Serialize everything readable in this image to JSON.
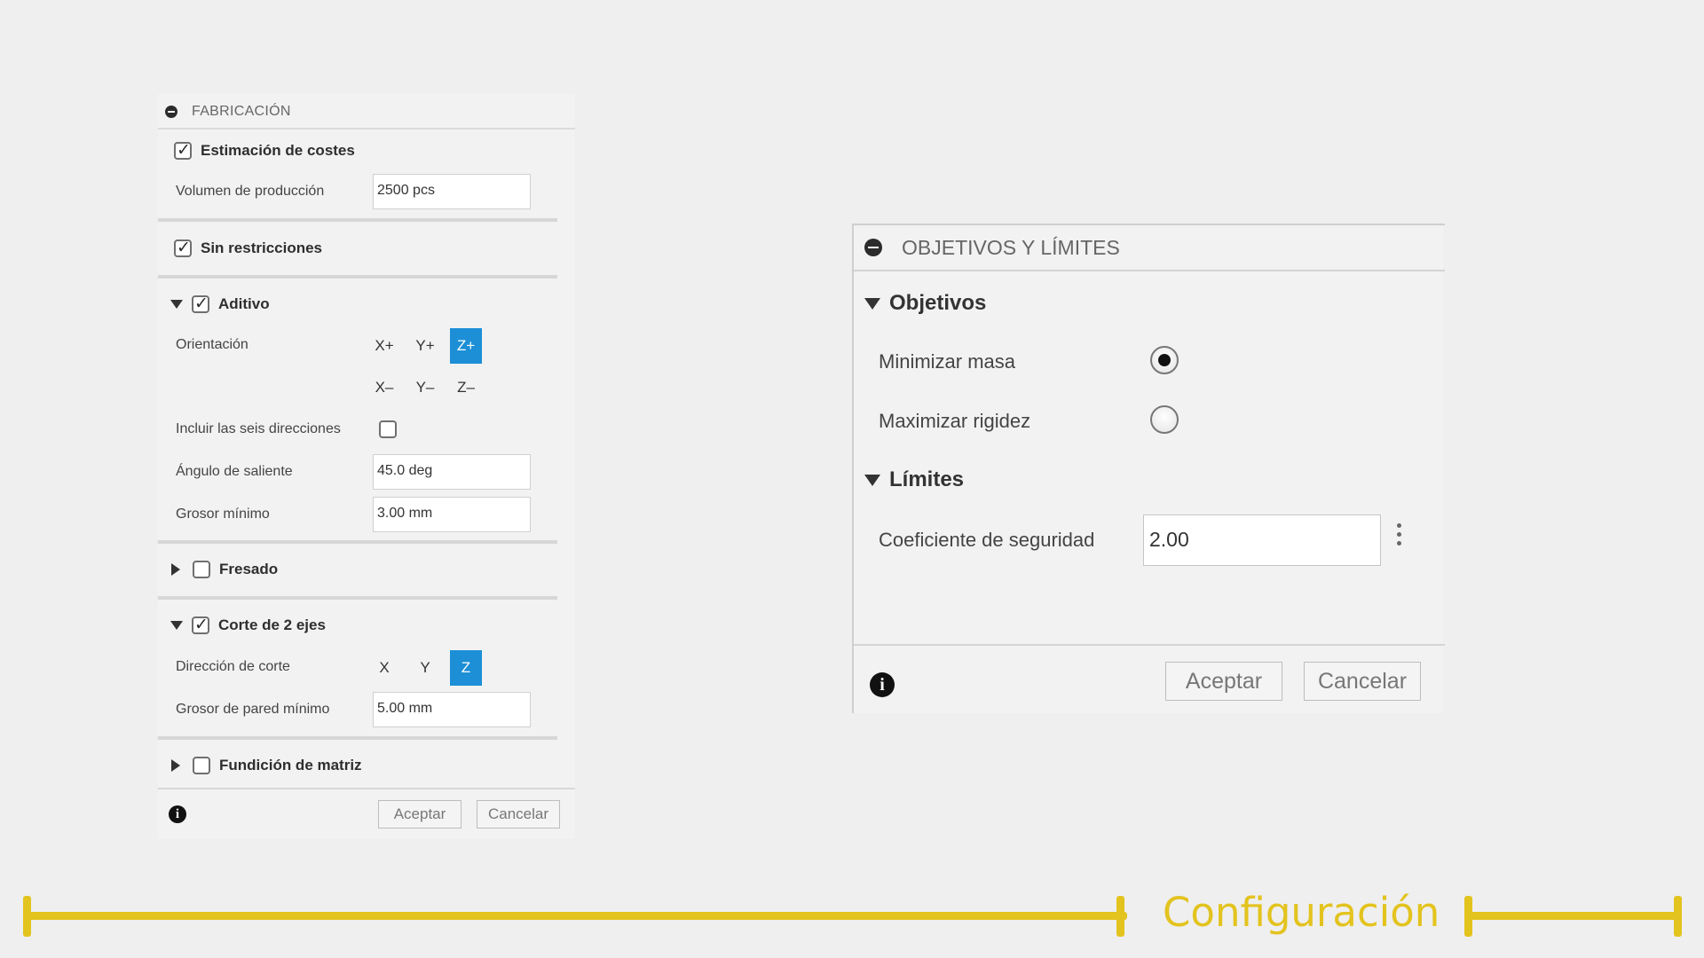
{
  "left_panel": {
    "title": "FABRICACIÓN",
    "cost_estimation": {
      "label": "Estimación de costes",
      "checked": true
    },
    "production_volume": {
      "label": "Volumen de producción",
      "value": "2500 pcs"
    },
    "unrestricted": {
      "label": "Sin restricciones",
      "checked": true
    },
    "additive": {
      "label": "Aditivo",
      "checked": true,
      "expanded": true,
      "orientation_label": "Orientación",
      "orientation_positive": [
        "X+",
        "Y+",
        "Z+"
      ],
      "orientation_negative": [
        "X–",
        "Y–",
        "Z–"
      ],
      "selected": "Z+",
      "six_directions_label": "Incluir las seis direcciones",
      "six_directions_checked": false,
      "overhang_label": "Ángulo de saliente",
      "overhang_value": "45.0 deg",
      "min_thickness_label": "Grosor mínimo",
      "min_thickness_value": "3.00 mm"
    },
    "milling": {
      "label": "Fresado",
      "checked": false,
      "expanded": false
    },
    "two_axis": {
      "label": "Corte de 2 ejes",
      "checked": true,
      "expanded": true,
      "direction_label": "Dirección de corte",
      "directions": [
        "X",
        "Y",
        "Z"
      ],
      "selected": "Z",
      "min_wall_label": "Grosor de pared mínimo",
      "min_wall_value": "5.00 mm"
    },
    "die_casting": {
      "label": "Fundición de matriz",
      "checked": false,
      "expanded": false
    },
    "ok_label": "Aceptar",
    "cancel_label": "Cancelar",
    "info_glyph": "i"
  },
  "right_panel": {
    "title": "OBJETIVOS Y LÍMITES",
    "objectives_label": "Objetivos",
    "minimize_mass_label": "Minimizar masa",
    "minimize_mass_selected": true,
    "maximize_stiffness_label": "Maximizar rigidez",
    "maximize_stiffness_selected": false,
    "limits_label": "Límites",
    "safety_factor_label": "Coeficiente de seguridad",
    "safety_factor_value": "2.00",
    "ok_label": "Aceptar",
    "cancel_label": "Cancelar",
    "info_glyph": "i"
  },
  "timeline": {
    "label": "Configuración",
    "color": "#e3c31e"
  },
  "colors": {
    "selected_axis": "#1c8fd6",
    "background": "#efefef"
  },
  "icons": [
    "collapse-icon",
    "checkbox-icon",
    "expand-triangle-icon",
    "info-icon",
    "more-options-icon"
  ]
}
